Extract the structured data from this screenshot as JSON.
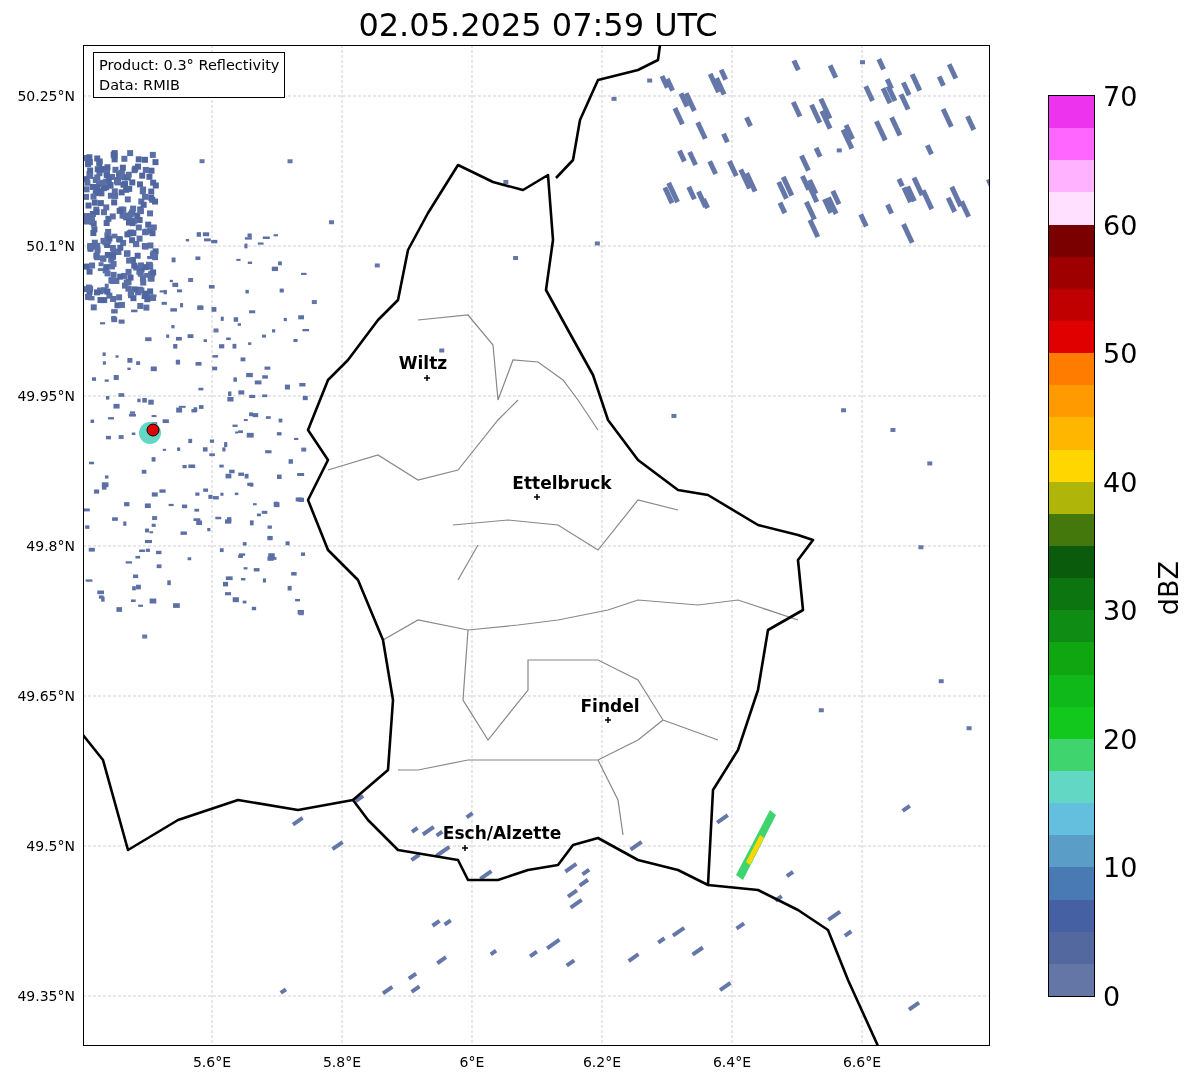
{
  "title": "02.05.2025 07:59 UTC",
  "info_box": {
    "lines": [
      "Product: 0.3° Reflectivity",
      "Data: RMIB"
    ]
  },
  "map": {
    "lat_ticks": [
      "50.25°N",
      "50.1°N",
      "49.95°N",
      "49.8°N",
      "49.65°N",
      "49.5°N",
      "49.35°N"
    ],
    "lon_ticks": [
      "5.6°E",
      "5.8°E",
      "6°E",
      "6.2°E",
      "6.4°E",
      "6.6°E"
    ],
    "cities": [
      {
        "name": "Wiltz"
      },
      {
        "name": "Ettelbruck"
      },
      {
        "name": "Findel"
      },
      {
        "name": "Esch/Alzette"
      }
    ]
  },
  "colorbar": {
    "label": "dBZ",
    "ticks": [
      "70",
      "60",
      "50",
      "40",
      "30",
      "20",
      "10",
      "0"
    ],
    "bands": [
      {
        "color": "#ee33ee"
      },
      {
        "color": "#ff66ff"
      },
      {
        "color": "#ffb2ff"
      },
      {
        "color": "#ffe0ff"
      },
      {
        "color": "#7a0000"
      },
      {
        "color": "#9e0000"
      },
      {
        "color": "#c00000"
      },
      {
        "color": "#e10000"
      },
      {
        "color": "#ff7c00"
      },
      {
        "color": "#ff9a00"
      },
      {
        "color": "#ffb600"
      },
      {
        "color": "#ffd600"
      },
      {
        "color": "#b0b50a"
      },
      {
        "color": "#44770c"
      },
      {
        "color": "#0a5c0c"
      },
      {
        "color": "#0c7510"
      },
      {
        "color": "#0e8c14"
      },
      {
        "color": "#10a612"
      },
      {
        "color": "#10b91a"
      },
      {
        "color": "#12c81c"
      },
      {
        "color": "#3fd46e"
      },
      {
        "color": "#62d8c4"
      },
      {
        "color": "#64bede"
      },
      {
        "color": "#5a9ec8"
      },
      {
        "color": "#4a7ab3"
      },
      {
        "color": "#4661a3"
      },
      {
        "color": "#5468a0"
      },
      {
        "color": "#6476a6"
      }
    ]
  }
}
